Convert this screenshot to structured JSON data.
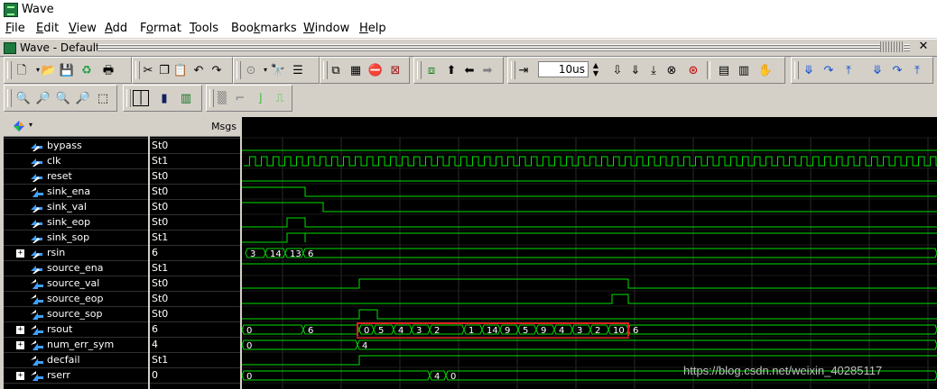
{
  "window": {
    "title": "Wave"
  },
  "menu": [
    "File",
    "Edit",
    "View",
    "Add",
    "Format",
    "Tools",
    "Bookmarks",
    "Window",
    "Help"
  ],
  "menu_underline": [
    "F",
    "E",
    "V",
    "A",
    "o",
    "T",
    "k",
    "W",
    "H"
  ],
  "subwindow": {
    "title": "Wave - Default"
  },
  "toolbar": {
    "time_value": "10us"
  },
  "panes": {
    "msgs_header": "Msgs"
  },
  "signals": [
    {
      "name": "bypass",
      "value": "St0",
      "expandable": false,
      "kind": "in"
    },
    {
      "name": "clk",
      "value": "St1",
      "expandable": false,
      "kind": "in"
    },
    {
      "name": "reset",
      "value": "St0",
      "expandable": false,
      "kind": "in"
    },
    {
      "name": "sink_ena",
      "value": "St0",
      "expandable": false,
      "kind": "out"
    },
    {
      "name": "sink_val",
      "value": "St0",
      "expandable": false,
      "kind": "in"
    },
    {
      "name": "sink_eop",
      "value": "St0",
      "expandable": false,
      "kind": "in"
    },
    {
      "name": "sink_sop",
      "value": "St1",
      "expandable": false,
      "kind": "in"
    },
    {
      "name": "rsin",
      "value": "6",
      "expandable": true,
      "kind": "in"
    },
    {
      "name": "source_ena",
      "value": "St1",
      "expandable": false,
      "kind": "in"
    },
    {
      "name": "source_val",
      "value": "St0",
      "expandable": false,
      "kind": "out"
    },
    {
      "name": "source_eop",
      "value": "St0",
      "expandable": false,
      "kind": "out"
    },
    {
      "name": "source_sop",
      "value": "St0",
      "expandable": false,
      "kind": "out"
    },
    {
      "name": "rsout",
      "value": "6",
      "expandable": true,
      "kind": "out"
    },
    {
      "name": "num_err_sym",
      "value": "4",
      "expandable": true,
      "kind": "out"
    },
    {
      "name": "decfail",
      "value": "St1",
      "expandable": false,
      "kind": "out"
    },
    {
      "name": "rserr",
      "value": "0",
      "expandable": true,
      "kind": "out"
    }
  ],
  "bus_labels": {
    "rsin": [
      "3",
      "14",
      "13",
      "6"
    ],
    "rsout": [
      "0",
      "6",
      "5",
      "4",
      "3",
      "2",
      "1",
      "14",
      "9",
      "5",
      "9",
      "4",
      "3",
      "2",
      "10",
      "6"
    ],
    "num_err_sym": [
      "0",
      "4"
    ],
    "rserr": [
      "0",
      "4",
      "0"
    ]
  },
  "highlight_color": "#e02020",
  "wave_color": "#00e000",
  "watermark": "https://blog.csdn.net/weixin_40285117"
}
